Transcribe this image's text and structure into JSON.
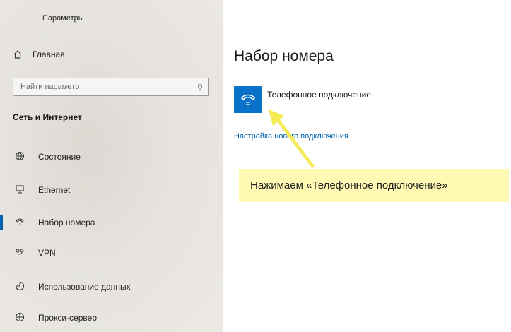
{
  "app": {
    "title": "Параметры"
  },
  "sidebar": {
    "home_label": "Главная",
    "search": {
      "placeholder": "Найти параметр"
    },
    "section_title": "Сеть и Интернет",
    "items": [
      {
        "label": "Состояние",
        "icon": "globe-icon",
        "active": false
      },
      {
        "label": "Ethernet",
        "icon": "ethernet-icon",
        "active": false
      },
      {
        "label": "Набор номера",
        "icon": "phone-icon",
        "active": true
      },
      {
        "label": "VPN",
        "icon": "vpn-icon",
        "active": false
      },
      {
        "label": "Использование данных",
        "icon": "data-usage-icon",
        "active": false
      },
      {
        "label": "Прокси-сервер",
        "icon": "globe-icon",
        "active": false
      }
    ]
  },
  "main": {
    "title": "Набор номера",
    "connection": {
      "label": "Телефонное подключение",
      "icon": "phone-icon"
    },
    "setup_link": "Настройка нового подключения"
  },
  "annotation": {
    "text": "Нажимаем «Телефонное подключение»"
  },
  "colors": {
    "accent": "#0063b1",
    "tile": "#0a73c9",
    "callout": "#fff9b3",
    "arrow": "#f5e94a"
  }
}
